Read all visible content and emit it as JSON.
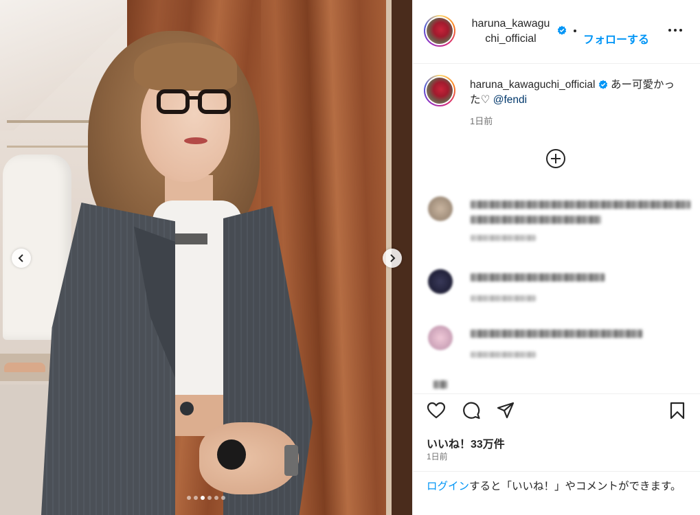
{
  "post": {
    "username": "haruna_kawaguchi_official",
    "username_header_line1": "haruna_kawagu",
    "username_header_line2": "chi_official",
    "follow_label": "フォローする",
    "caption_text": "あー可愛かった♡",
    "caption_mention": "@fendi",
    "caption_time": "1日前",
    "likes": "いいね！33万件",
    "date": "1日前",
    "carousel": {
      "total": 6,
      "active_index": 2
    }
  },
  "login_bar": {
    "link_label": "ログイン",
    "rest_text": "すると「いいね！」やコメントができます。"
  },
  "colors": {
    "accent": "#0095f6",
    "mention": "#00376b",
    "text": "#262626",
    "muted": "#737373",
    "verified": "#0095f6"
  },
  "icons": [
    "more-options-icon",
    "verified-badge-icon",
    "add-comment-icon",
    "heart-icon",
    "comment-icon",
    "share-icon",
    "bookmark-icon",
    "chevron-left-icon",
    "chevron-right-icon"
  ]
}
